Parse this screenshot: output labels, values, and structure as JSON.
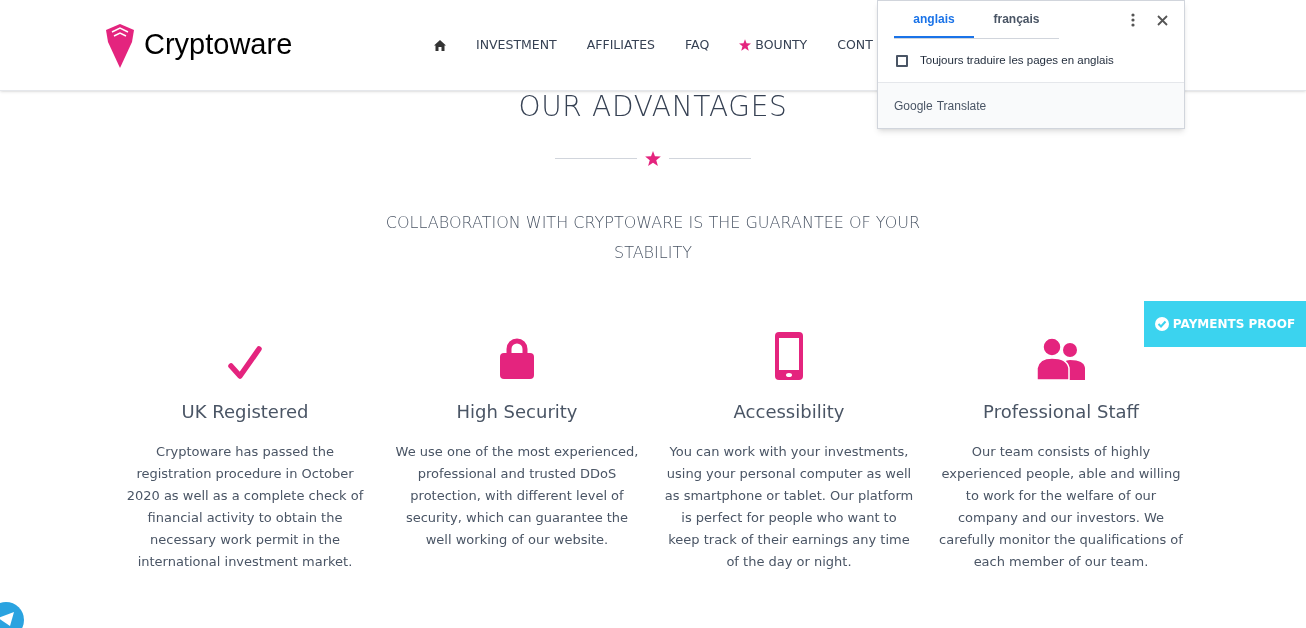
{
  "header": {
    "logo": "Cryptoware",
    "nav": [
      {
        "kind": "home"
      },
      {
        "kind": "text",
        "label": "INVESTMENT"
      },
      {
        "kind": "text",
        "label": "AFFILIATES"
      },
      {
        "kind": "text",
        "label": "FAQ"
      },
      {
        "kind": "star",
        "label": "BOUNTY"
      },
      {
        "kind": "text",
        "label": "CONT"
      }
    ]
  },
  "section": {
    "title": "OUR ADVANTAGES",
    "subtitle": "COLLABORATION WITH CRYPTOWARE IS THE GUARANTEE OF YOUR STABILITY",
    "features": [
      {
        "kind": "check",
        "title": "UK Registered",
        "text": "Cryptoware has passed the registration procedure in October 2020 as well as a complete check of financial activity to obtain the necessary work permit in the international investment market."
      },
      {
        "kind": "lock",
        "title": "High Security",
        "text": "We use one of the most experienced, professional and trusted DDoS protection, with different level of security, which can guarantee the well working of our website."
      },
      {
        "kind": "phone",
        "title": "Accessibility",
        "text": "You can work with your investments, using your personal computer as well as smartphone or tablet. Our platform is perfect for people who want to keep track of their earnings any time of the day or night."
      },
      {
        "kind": "users",
        "title": "Professional Staff",
        "text": "Our team consists of highly experienced people, able and willing to work for the welfare of our company and our investors. We carefully monitor the qualifications of each member of our team."
      }
    ]
  },
  "payments_button": "PAYMENTS PROOF",
  "translate_popup": {
    "tabs": [
      {
        "label": "anglais",
        "selected": true
      },
      {
        "label": "français",
        "selected": false
      }
    ],
    "option": {
      "label": "Toujours traduire les pages en anglais",
      "checked": false
    },
    "footer_brand": "Google",
    "footer_product": "Translate"
  }
}
